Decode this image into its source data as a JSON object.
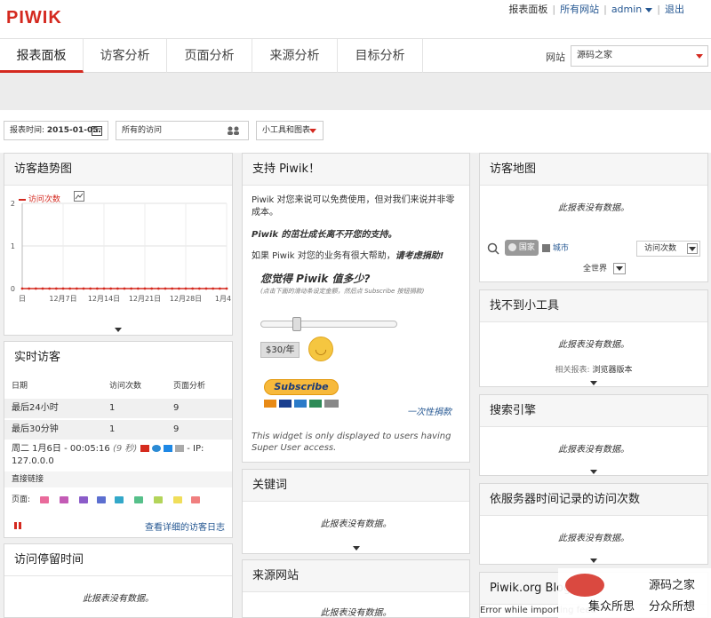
{
  "header": {
    "logo": "PIWIK",
    "links": [
      "报表面板",
      "所有网站",
      "admin",
      "退出"
    ]
  },
  "nav": {
    "tabs": [
      "报表面板",
      "访客分析",
      "页面分析",
      "来源分析",
      "目标分析"
    ],
    "site_label": "网站",
    "site_value": "源码之家"
  },
  "controls": {
    "date_label": "报表时间:",
    "date_value": "2015-01-05",
    "segment": "所有的访问",
    "widgets_menu": "小工具和图表"
  },
  "visits_overview": {
    "title": "访客趋势图",
    "legend": "访问次数",
    "y_ticks": [
      "2",
      "1",
      "0"
    ],
    "x_ticks": [
      "日",
      "12月7日",
      "12月14日",
      "12月21日",
      "12月28日",
      "1月4日"
    ]
  },
  "chart_data": {
    "type": "line",
    "title": "访客趋势图",
    "categories": [
      "日",
      "12月7日",
      "12月14日",
      "12月21日",
      "12月28日",
      "1月4日"
    ],
    "series": [
      {
        "name": "访问次数",
        "values": [
          0,
          0,
          0,
          0,
          0,
          0
        ]
      }
    ],
    "ylim": [
      0,
      2
    ],
    "grid": true,
    "legend": "top-left"
  },
  "realtime": {
    "title": "实时访客",
    "columns": [
      "日期",
      "访问次数",
      "页面分析"
    ],
    "rows": [
      {
        "label": "最后24小时",
        "visits": "1",
        "pages": "9"
      },
      {
        "label": "最后30分钟",
        "visits": "1",
        "pages": "9"
      }
    ],
    "visit_line1": "周二 1月6日 - 00:05:16",
    "visit_duration": "(9 秒)",
    "visit_ip": "- IP:",
    "visit_line2": "127.0.0.0",
    "referrer": "直接链接",
    "pages_label": "页面:",
    "log_link": "查看详细的访客日志"
  },
  "visit_length": {
    "title": "访问停留时间",
    "nodata": "此报表没有数据。"
  },
  "support": {
    "title": "支持 Piwik！",
    "p1": "Piwik 对您来说可以免费使用，但对我们来说并非零成本。",
    "p2": "Piwik 的茁壮成长离不开您的支持。",
    "p3a": "如果 Piwik 对您的业务有很大帮助，",
    "p3b": "请考虑捐助!",
    "question": "您觉得 Piwik 值多少?",
    "hint": "(点击下面的滑动条设定金额，然后点 Subscribe 按钮捐款)",
    "amount": "$30/年",
    "subscribe": "Subscribe",
    "one_time": "一次性捐款",
    "note": "This widget is only displayed to users having Super User access."
  },
  "keywords": {
    "title": "关键词",
    "nodata": "此报表没有数据。"
  },
  "websites": {
    "title": "来源网站",
    "nodata": "此报表没有数据。"
  },
  "visitor_map": {
    "title": "访客地图",
    "nodata": "此报表没有数据。",
    "country": "国家",
    "city": "城市",
    "metric": "访问次数",
    "region": "全世界"
  },
  "missing_widget": {
    "title": "找不到小工具",
    "nodata": "此报表没有数据。",
    "related": "相关报表: ",
    "related_link": "浏览器版本"
  },
  "search_engines": {
    "title": "搜索引擎",
    "nodata": "此报表没有数据。"
  },
  "server_time": {
    "title": "依服务器时间记录的访问次数",
    "nodata": "此报表没有数据。"
  },
  "piwik_org": {
    "title": "Piwik.org Blog",
    "error": "Error while importing feed"
  },
  "watermark": {
    "name": "源码之家",
    "slogan1": "集众所思",
    "slogan2": "分众所想"
  },
  "colors": {
    "accent": "#d4291f",
    "link": "#255792"
  }
}
